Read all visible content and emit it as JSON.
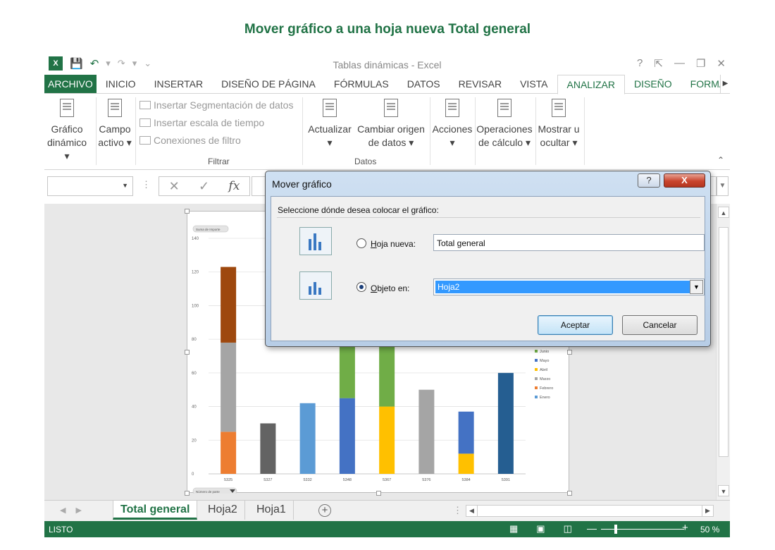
{
  "page_title": "Mover gráfico a una hoja nueva Total general",
  "window": {
    "title": "Tablas dinámicas - Excel",
    "logo": "X",
    "controls": [
      "?",
      "⇱",
      "—",
      "❐",
      "✕"
    ]
  },
  "ribbon_tabs": [
    "ARCHIVO",
    "INICIO",
    "INSERTAR",
    "DISEÑO DE PÁGINA",
    "FÓRMULAS",
    "DATOS",
    "REVISAR",
    "VISTA",
    "ANALIZAR",
    "DISEÑO",
    "FORMATO"
  ],
  "active_tab": "ANALIZAR",
  "ribbon": {
    "grafico_dinamico": {
      "line1": "Gráfico",
      "line2": "dinámico ▾"
    },
    "campo_activo": {
      "line1": "Campo",
      "line2": "activo ▾"
    },
    "filtrar": {
      "items": [
        "Insertar Segmentación de datos",
        "Insertar escala de tiempo",
        "Conexiones de filtro"
      ],
      "label": "Filtrar"
    },
    "datos": {
      "actualizar": {
        "line1": "Actualizar",
        "line2": "▾"
      },
      "cambiar_origen": {
        "line1": "Cambiar origen",
        "line2": "de datos ▾"
      },
      "label": "Datos"
    },
    "acciones": {
      "line1": "Acciones",
      "line2": "▾"
    },
    "operaciones": {
      "line1": "Operaciones",
      "line2": "de cálculo ▾"
    },
    "mostrar": {
      "line1": "Mostrar u",
      "line2": "ocultar ▾"
    }
  },
  "formula_bar": {
    "name_box": "",
    "cancel": "✕",
    "enter": "✓",
    "fx": "fx"
  },
  "chart_data": {
    "type": "bar",
    "stacked": true,
    "field_button_top": "Suma de Importe",
    "field_button_bottom": "Número de parte",
    "categories": [
      "5325",
      "5327",
      "5332",
      "5348",
      "5367",
      "5376",
      "5384",
      "5391"
    ],
    "ylim": [
      0,
      140
    ],
    "yticks": [
      0,
      20,
      40,
      60,
      80,
      100,
      120,
      140
    ],
    "grid": true,
    "legend_position": "right",
    "series": [
      {
        "name": "Enero",
        "color": "#5b9bd5",
        "values": [
          0,
          0,
          42,
          0,
          0,
          0,
          0,
          0
        ]
      },
      {
        "name": "Febrero",
        "color": "#ed7d31",
        "values": [
          25,
          0,
          0,
          0,
          0,
          0,
          0,
          0
        ]
      },
      {
        "name": "Marzo",
        "color": "#a5a5a5",
        "values": [
          53,
          0,
          0,
          0,
          0,
          50,
          0,
          0
        ]
      },
      {
        "name": "Abril",
        "color": "#ffc000",
        "values": [
          0,
          0,
          0,
          0,
          40,
          0,
          12,
          0
        ]
      },
      {
        "name": "Mayo",
        "color": "#4472c4",
        "values": [
          0,
          0,
          0,
          45,
          0,
          0,
          25,
          0
        ]
      },
      {
        "name": "Junio",
        "color": "#70ad47",
        "values": [
          0,
          0,
          0,
          35,
          40,
          0,
          0,
          0
        ]
      },
      {
        "name": "",
        "color": "#636363",
        "values": [
          0,
          30,
          0,
          0,
          0,
          0,
          0,
          0
        ]
      },
      {
        "name": "",
        "color": "#9e480e",
        "values": [
          45,
          0,
          0,
          0,
          0,
          0,
          0,
          0
        ]
      },
      {
        "name": "",
        "color": "#255e91",
        "values": [
          0,
          0,
          0,
          0,
          0,
          0,
          0,
          60
        ]
      }
    ],
    "legend_visible": [
      "Junio",
      "Mayo",
      "Abril",
      "Marzo",
      "Febrero",
      "Enero"
    ]
  },
  "dialog": {
    "title": "Mover gráfico",
    "help": "?",
    "close": "X",
    "prompt": "Seleccione dónde desea colocar el gráfico:",
    "new_sheet_label_hotkey": "H",
    "new_sheet_label_rest": "oja nueva:",
    "new_sheet_value": "Total general",
    "object_label_hotkey": "O",
    "object_label_rest": "bjeto en:",
    "object_value": "Hoja2",
    "selected": "object",
    "ok": "Aceptar",
    "cancel": "Cancelar"
  },
  "sheet_tabs": [
    "Total general",
    "Hoja2",
    "Hoja1"
  ],
  "active_sheet": "Total general",
  "status": {
    "text": "LISTO",
    "zoom": "50 %",
    "minus": "—",
    "plus": "+"
  }
}
